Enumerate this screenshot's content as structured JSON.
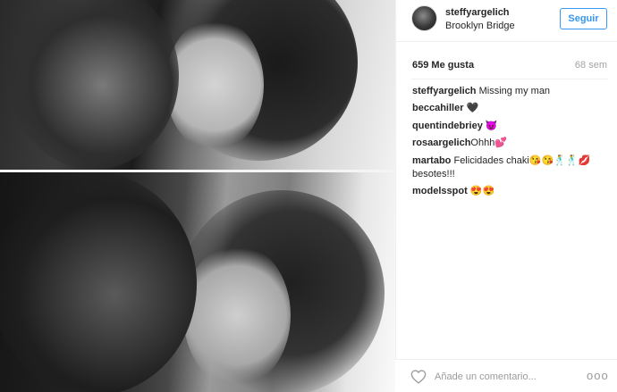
{
  "post": {
    "username": "steffyargelich",
    "location": "Brooklyn Bridge",
    "follow_label": "Seguir",
    "likes": "659 Me gusta",
    "time_ago": "68 sem"
  },
  "comments": [
    {
      "user": "steffyargelich",
      "text": "Missing my man"
    },
    {
      "user": "beccahiller",
      "text": "🖤"
    },
    {
      "user": "quentindebriey",
      "text": "😈"
    },
    {
      "user": "rosaargelich",
      "text": "Ohhh💕"
    },
    {
      "user": "martabo",
      "text": "Felicidades chaki😘😘🕺🕺💋 besotes!!!"
    },
    {
      "user": "modelsspot",
      "text": "😍😍"
    }
  ],
  "composer": {
    "placeholder": "Añade un comentario...",
    "more_label": "ooo"
  },
  "icons": {
    "like": "heart-outline-icon",
    "more": "more-options-icon"
  },
  "colors": {
    "accent": "#3897f0",
    "muted": "#a3a3a3",
    "text": "#262626"
  }
}
